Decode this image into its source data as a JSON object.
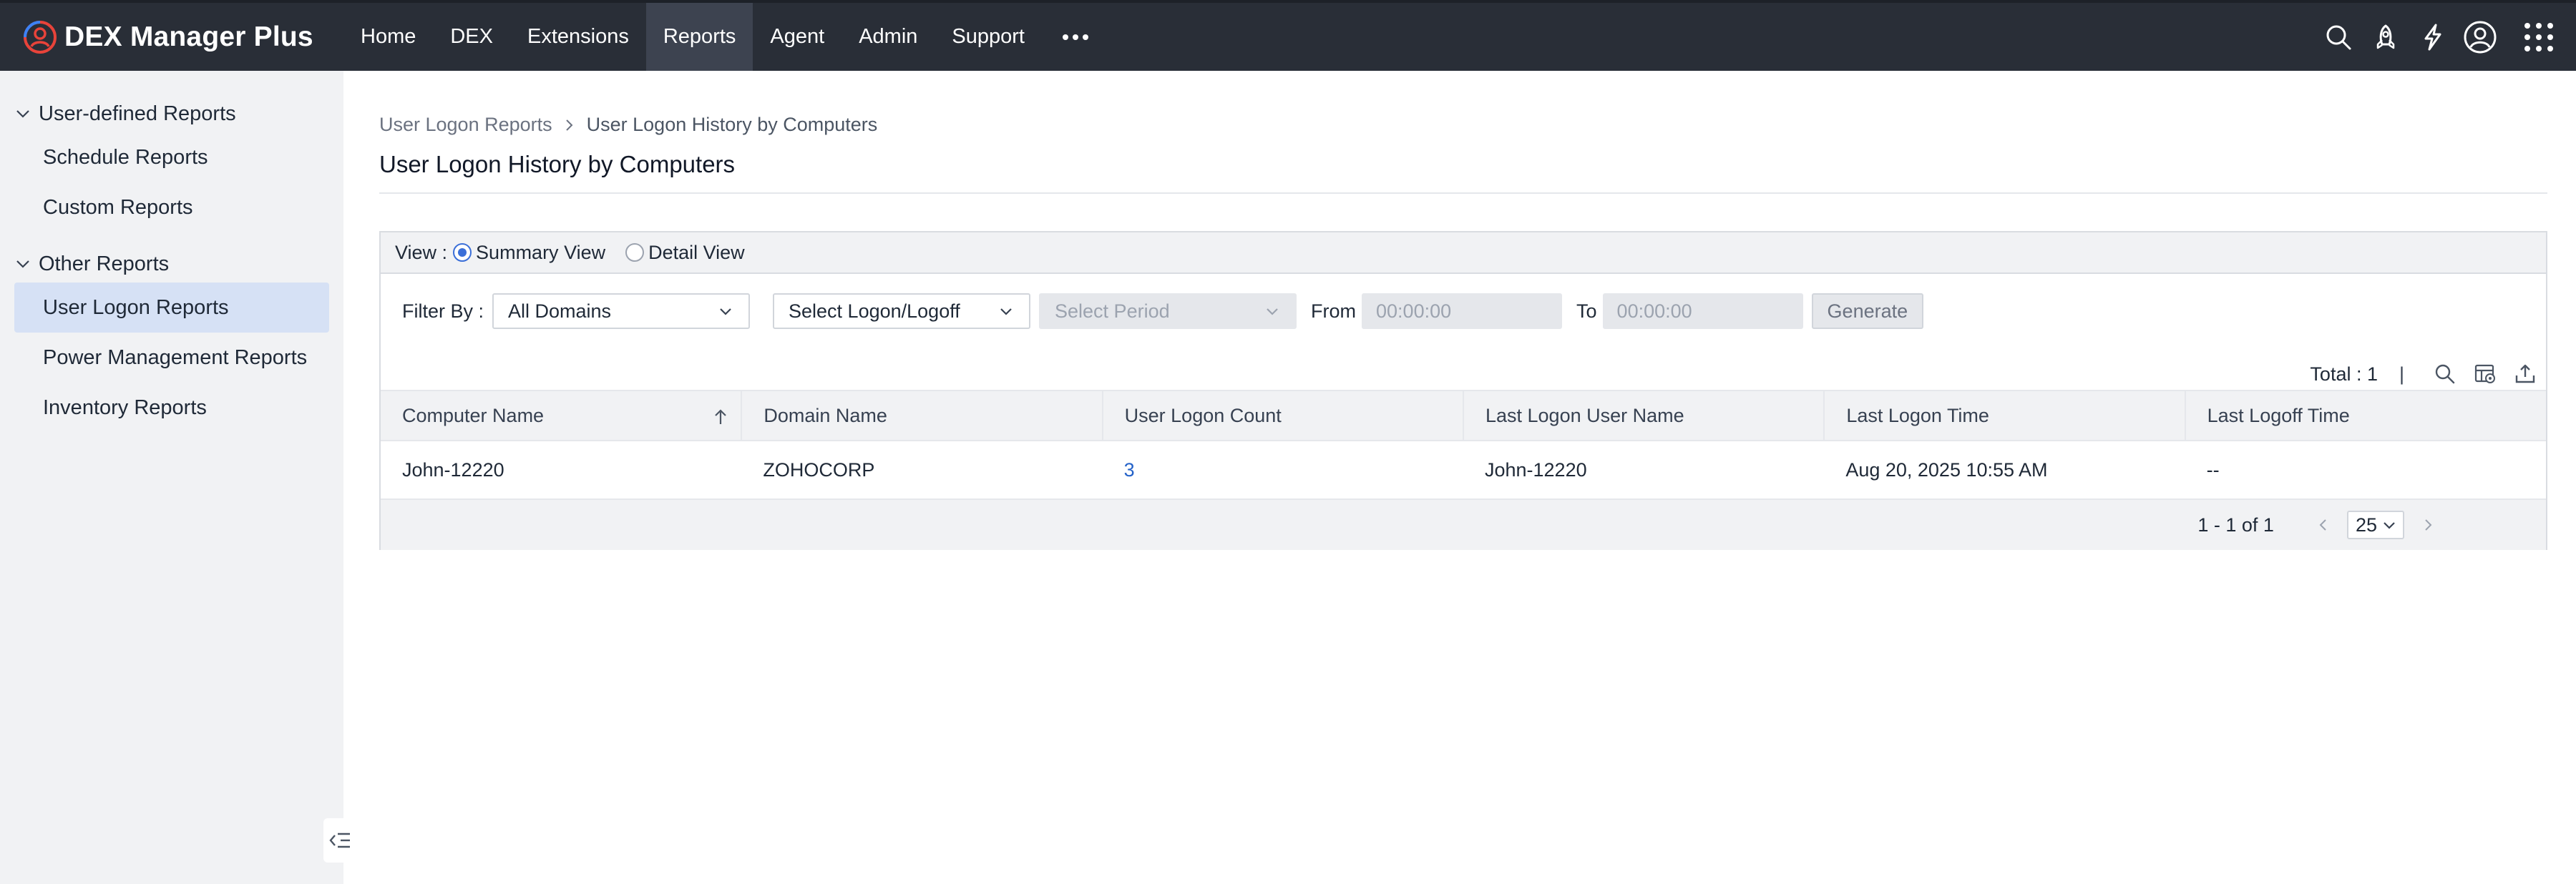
{
  "app": {
    "name": "DEX Manager Plus"
  },
  "nav": {
    "items": [
      {
        "label": "Home"
      },
      {
        "label": "DEX"
      },
      {
        "label": "Extensions"
      },
      {
        "label": "Reports"
      },
      {
        "label": "Agent"
      },
      {
        "label": "Admin"
      },
      {
        "label": "Support"
      }
    ],
    "active": "Reports",
    "right_icons": [
      "search-icon",
      "rocket-icon",
      "lightning-icon",
      "user-profile-icon",
      "apps-grid-icon"
    ]
  },
  "sidebar": {
    "groups": [
      {
        "label": "User-defined Reports",
        "items": [
          {
            "label": "Schedule Reports"
          },
          {
            "label": "Custom Reports"
          }
        ]
      },
      {
        "label": "Other Reports",
        "items": [
          {
            "label": "User Logon Reports"
          },
          {
            "label": "Power Management Reports"
          },
          {
            "label": "Inventory Reports"
          }
        ]
      }
    ],
    "active_item": "User Logon Reports"
  },
  "breadcrumb": {
    "parent": "User Logon Reports",
    "current": "User Logon History by Computers"
  },
  "page": {
    "title": "User Logon History by Computers"
  },
  "view": {
    "label": "View :",
    "options": [
      {
        "label": "Summary View",
        "selected": true
      },
      {
        "label": "Detail View",
        "selected": false
      }
    ]
  },
  "filters": {
    "label": "Filter By :",
    "domain": "All Domains",
    "logon_type": "Select Logon/Logoff",
    "period": "Select Period",
    "from_label": "From",
    "from_value": "00:00:00",
    "to_label": "To",
    "to_value": "00:00:00",
    "generate_label": "Generate"
  },
  "tools": {
    "total_label": "Total : 1",
    "separator": "|"
  },
  "table": {
    "columns": [
      "Computer Name",
      "Domain Name",
      "User Logon Count",
      "Last Logon User Name",
      "Last Logon Time",
      "Last Logoff Time"
    ],
    "rows": [
      [
        "John-12220",
        "ZOHOCORP",
        "3",
        "John-12220",
        "Aug 20, 2025 10:55 AM",
        "--"
      ]
    ]
  },
  "pagination": {
    "range": "1 - 1 of 1",
    "page_size": "25"
  },
  "colors": {
    "topbar": "#292e37",
    "active_nav": "#3d4350",
    "sidebar": "#f1f2f4",
    "sidebar_active": "#d6e1f5",
    "link": "#2563c9",
    "radio": "#3b6fd8",
    "brand_logo": "#e8433a"
  }
}
